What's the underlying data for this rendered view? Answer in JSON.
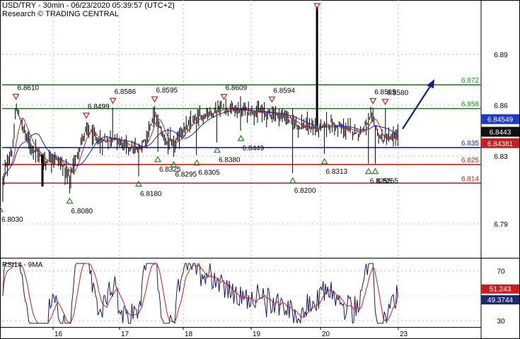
{
  "header": {
    "line1": "USD/TRY - 30min - 06/23/2020 05:39:57 (UTC+2)",
    "line2": "Research © TRADING CENTRAL"
  },
  "chart_data": [
    {
      "type": "line",
      "panel": "price",
      "y_ticks": [
        6.89,
        6.86,
        6.83,
        6.79
      ],
      "y_visible_range": [
        6.77,
        6.922
      ],
      "x_tick_labels": [
        "16",
        "17",
        "18",
        "19",
        "20",
        "23"
      ],
      "levels": [
        {
          "label": "6.872",
          "value": 6.872,
          "color": "#1e8a1e"
        },
        {
          "label": "6.858",
          "value": 6.858,
          "color": "#1e8a1e"
        },
        {
          "label": "6.835",
          "value": 6.835,
          "color": "#1e1ebe"
        },
        {
          "label": "6.825",
          "value": 6.825,
          "color": "#c81e1e"
        },
        {
          "label": "6.814",
          "value": 6.814,
          "color": "#c81e1e"
        }
      ],
      "current_price_boxes": [
        {
          "label": "6.84549",
          "value": 6.84549,
          "bg": "#1e3cbe",
          "fg": "#ffffff"
        },
        {
          "label": "6.8443",
          "value": 6.8443,
          "bg": "#111111",
          "fg": "#ffffff"
        },
        {
          "label": "6.84381",
          "value": 6.84381,
          "bg": "#c81e1e",
          "fg": "#ffffff"
        }
      ],
      "swing_highs": [
        {
          "label": "6.8610",
          "x": 15.3,
          "value": 6.861
        },
        {
          "label": "6.8499",
          "x": 16.5,
          "value": 6.8499
        },
        {
          "label": "6.8586",
          "x": 16.9,
          "value": 6.8586
        },
        {
          "label": "6.8595",
          "x": 17.55,
          "value": 6.8595
        },
        {
          "label": "6.8609",
          "x": 18.6,
          "value": 6.8609
        },
        {
          "label": "6.8594",
          "x": 19.3,
          "value": 6.8594
        },
        {
          "label": "6.8585",
          "x": 21.6,
          "value": 6.8585
        },
        {
          "label": "6.8580",
          "x": 22.2,
          "value": 6.858
        }
      ],
      "swing_lows": [
        {
          "label": "6.8030",
          "x": 15.0,
          "value": 6.803
        },
        {
          "label": "6.8080",
          "x": 16.25,
          "value": 6.808
        },
        {
          "label": "6.8180",
          "x": 17.3,
          "value": 6.818
        },
        {
          "label": "6.8325",
          "x": 17.6,
          "value": 6.8325
        },
        {
          "label": "6.8295",
          "x": 17.85,
          "value": 6.8295
        },
        {
          "label": "6.8305",
          "x": 18.2,
          "value": 6.8305
        },
        {
          "label": "6.8380",
          "x": 18.5,
          "value": 6.838
        },
        {
          "label": "6.8449",
          "x": 18.85,
          "value": 6.8449
        },
        {
          "label": "6.8200",
          "x": 19.6,
          "value": 6.82
        },
        {
          "label": "6.8313",
          "x": 20.1,
          "value": 6.8313
        },
        {
          "label": "6.8255",
          "x": 21.4,
          "value": 6.8255
        },
        {
          "label": "6.8255",
          "x": 21.7,
          "value": 6.8255
        }
      ],
      "spike": {
        "x": 19.95,
        "high": 6.918,
        "close": 6.848
      },
      "forecast_arrow": {
        "from_value": 6.846,
        "to_value": 6.872
      }
    },
    {
      "type": "line",
      "panel": "indicator",
      "title": "RSI14 - 9MA",
      "y_ticks": [
        70,
        30
      ],
      "y_visible_range": [
        25,
        80
      ],
      "series": [
        {
          "name": "RSI14",
          "color": "#1a1a6e",
          "last": 49.3744,
          "last_label": "49.3744"
        },
        {
          "name": "9MA",
          "color": "#c81e1e",
          "last": 51.243,
          "last_label": "51.243"
        }
      ],
      "midline": 50
    }
  ],
  "colors": {
    "green_level": "#1e8a1e",
    "blue_level": "#1e1ebe",
    "red_level": "#c81e1e",
    "high_marker": "#c81e1e",
    "low_marker": "#1e8a1e",
    "price_ma_fast": "#c81e1e",
    "price_ma_slow": "#1e1ebe",
    "arrow": "#0a1e8c"
  }
}
